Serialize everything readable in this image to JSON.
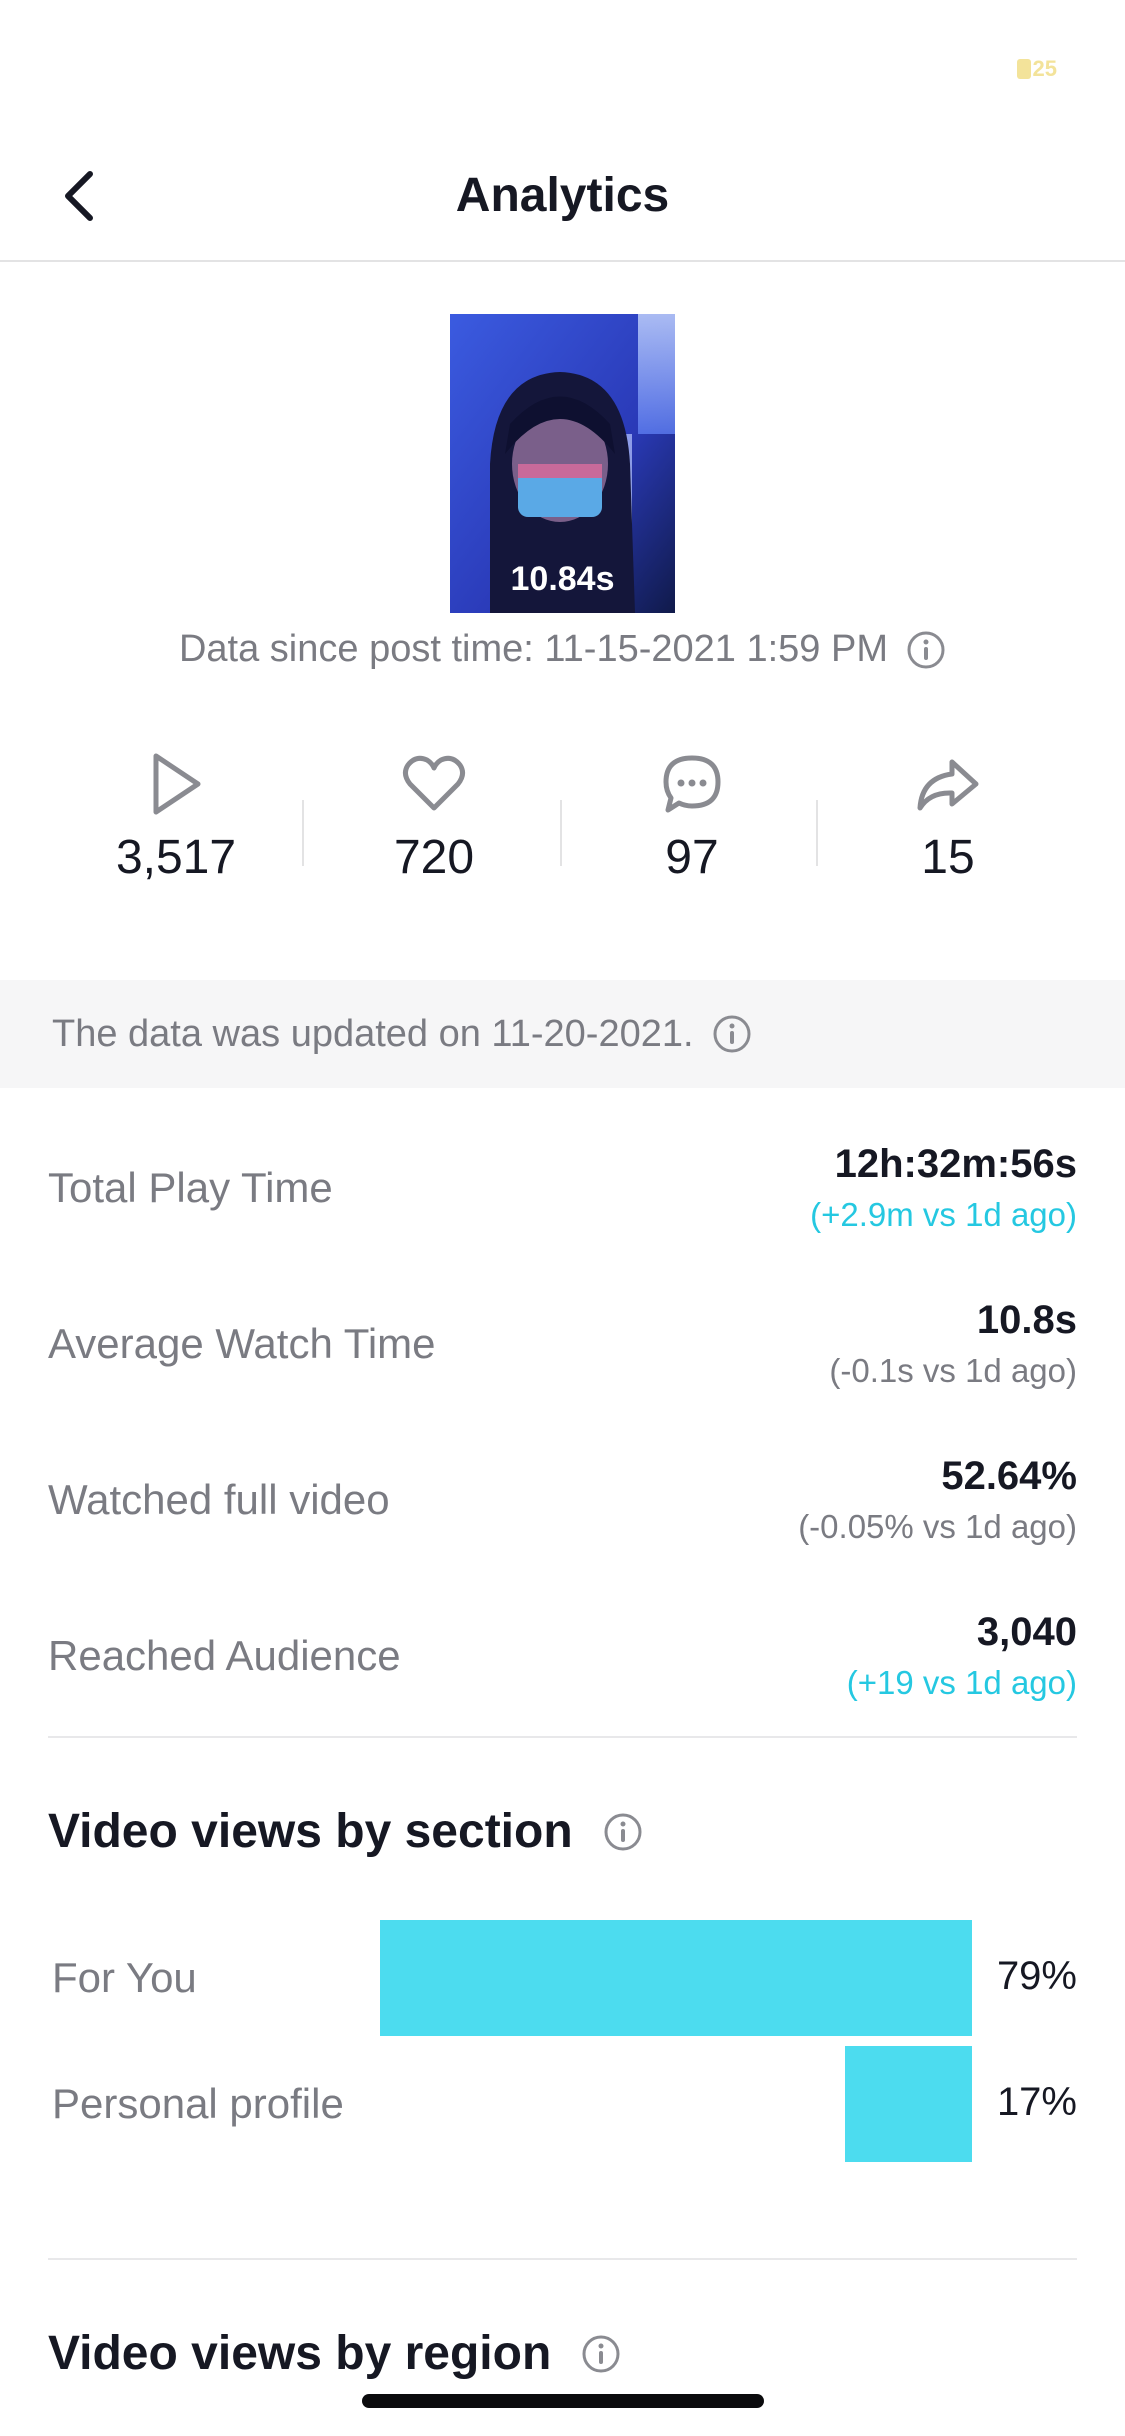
{
  "status_bar": {
    "battery": "25"
  },
  "nav": {
    "title": "Analytics"
  },
  "video": {
    "duration": "10.84s"
  },
  "post_info": {
    "since_label": "Data since post time: 11-15-2021 1:59 PM"
  },
  "metrics": [
    {
      "icon": "play-icon",
      "value": "3,517"
    },
    {
      "icon": "heart-icon",
      "value": "720"
    },
    {
      "icon": "comment-icon",
      "value": "97"
    },
    {
      "icon": "share-icon",
      "value": "15"
    }
  ],
  "updated_notice": "The data was updated on 11-20-2021.",
  "stats": [
    {
      "label": "Total Play Time",
      "value": "12h:32m:56s",
      "delta": "(+2.9m vs 1d ago)",
      "delta_color": "#25c8e1"
    },
    {
      "label": "Average Watch Time",
      "value": "10.8s",
      "delta": "(-0.1s vs 1d ago)",
      "delta_color": "#7a7b82"
    },
    {
      "label": "Watched full video",
      "value": "52.64%",
      "delta": "(-0.05% vs 1d ago)",
      "delta_color": "#7a7b82"
    },
    {
      "label": "Reached Audience",
      "value": "3,040",
      "delta": "(+19 vs 1d ago)",
      "delta_color": "#25c8e1"
    }
  ],
  "views_by_section": {
    "title": "Video views by section",
    "bars": [
      {
        "label": "For You",
        "percent_text": "79%",
        "fraction": 0.79
      },
      {
        "label": "Personal profile",
        "percent_text": "17%",
        "fraction": 0.17
      }
    ],
    "bar_color": "#4cdcef"
  },
  "views_by_region": {
    "title": "Video views by region"
  },
  "colors": {
    "accent": "#25c8e1",
    "bar": "#4cdcef",
    "text_primary": "#161823",
    "text_secondary": "#7a7b82"
  }
}
